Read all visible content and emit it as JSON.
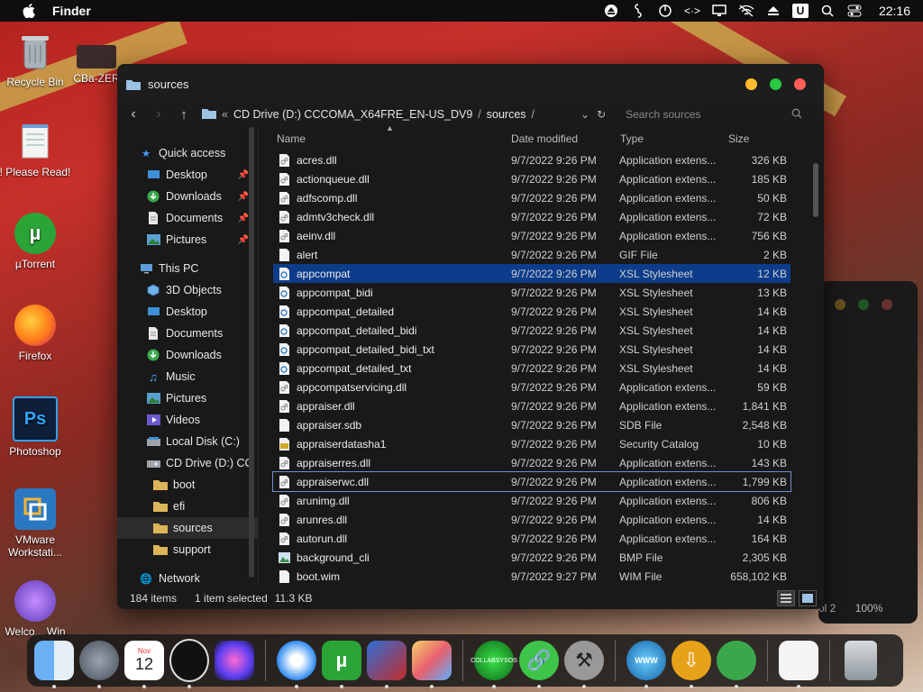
{
  "menubar": {
    "app_name": "Finder",
    "clock": "22:16"
  },
  "desktop": [
    {
      "label": "Recycle Bin",
      "icon": "recycle-bin-icon"
    },
    {
      "label": "CBa-ZER",
      "icon": "folder-photo-icon"
    },
    {
      "label": "! Please Read!",
      "icon": "notepad-icon"
    },
    {
      "label": "µTorrent",
      "icon": "utorrent-icon"
    },
    {
      "label": "Firefox",
      "icon": "firefox-icon"
    },
    {
      "label": "Photoshop",
      "icon": "photoshop-icon"
    },
    {
      "label": "VMware Workstati...",
      "icon": "vmware-icon"
    },
    {
      "label": "Welco... Win",
      "icon": "apple-icon"
    }
  ],
  "window": {
    "title": "sources",
    "breadcrumb": [
      "CD Drive (D:) CCCOMA_X64FRE_EN-US_DV9",
      "sources"
    ],
    "breadcrumb_prefix": "«",
    "search_placeholder": "Search sources"
  },
  "sidebar": {
    "quick_access": "Quick access",
    "quick_items": [
      {
        "label": "Desktop",
        "icon": "desktop-icon"
      },
      {
        "label": "Downloads",
        "icon": "download-icon"
      },
      {
        "label": "Documents",
        "icon": "documents-icon"
      },
      {
        "label": "Pictures",
        "icon": "pictures-icon"
      }
    ],
    "this_pc": "This PC",
    "pc_items": [
      {
        "label": "3D Objects",
        "icon": "cube-icon"
      },
      {
        "label": "Desktop",
        "icon": "desktop-icon"
      },
      {
        "label": "Documents",
        "icon": "documents-icon"
      },
      {
        "label": "Downloads",
        "icon": "download-icon"
      },
      {
        "label": "Music",
        "icon": "music-icon"
      },
      {
        "label": "Pictures",
        "icon": "pictures-icon"
      },
      {
        "label": "Videos",
        "icon": "videos-icon"
      },
      {
        "label": "Local Disk (C:)",
        "icon": "disk-icon"
      },
      {
        "label": "CD Drive (D:) CC",
        "icon": "cd-icon"
      }
    ],
    "cd_items": [
      {
        "label": "boot"
      },
      {
        "label": "efi"
      },
      {
        "label": "sources"
      },
      {
        "label": "support"
      }
    ],
    "network": "Network"
  },
  "columns": {
    "name": "Name",
    "date": "Date modified",
    "type": "Type",
    "size": "Size"
  },
  "files": [
    {
      "name": "acres.dll",
      "date": "9/7/2022 9:26 PM",
      "type": "Application extens...",
      "size": "326 KB",
      "icon": "dll-icon"
    },
    {
      "name": "actionqueue.dll",
      "date": "9/7/2022 9:26 PM",
      "type": "Application extens...",
      "size": "185 KB",
      "icon": "dll-icon"
    },
    {
      "name": "adfscomp.dll",
      "date": "9/7/2022 9:26 PM",
      "type": "Application extens...",
      "size": "50 KB",
      "icon": "dll-icon"
    },
    {
      "name": "admtv3check.dll",
      "date": "9/7/2022 9:26 PM",
      "type": "Application extens...",
      "size": "72 KB",
      "icon": "dll-icon"
    },
    {
      "name": "aeinv.dll",
      "date": "9/7/2022 9:26 PM",
      "type": "Application extens...",
      "size": "756 KB",
      "icon": "dll-icon"
    },
    {
      "name": "alert",
      "date": "9/7/2022 9:26 PM",
      "type": "GIF File",
      "size": "2 KB",
      "icon": "file-icon"
    },
    {
      "name": "appcompat",
      "date": "9/7/2022 9:26 PM",
      "type": "XSL Stylesheet",
      "size": "12 KB",
      "icon": "xsl-icon"
    },
    {
      "name": "appcompat_bidi",
      "date": "9/7/2022 9:26 PM",
      "type": "XSL Stylesheet",
      "size": "13 KB",
      "icon": "xsl-icon"
    },
    {
      "name": "appcompat_detailed",
      "date": "9/7/2022 9:26 PM",
      "type": "XSL Stylesheet",
      "size": "14 KB",
      "icon": "xsl-icon"
    },
    {
      "name": "appcompat_detailed_bidi",
      "date": "9/7/2022 9:26 PM",
      "type": "XSL Stylesheet",
      "size": "14 KB",
      "icon": "xsl-icon"
    },
    {
      "name": "appcompat_detailed_bidi_txt",
      "date": "9/7/2022 9:26 PM",
      "type": "XSL Stylesheet",
      "size": "14 KB",
      "icon": "xsl-icon"
    },
    {
      "name": "appcompat_detailed_txt",
      "date": "9/7/2022 9:26 PM",
      "type": "XSL Stylesheet",
      "size": "14 KB",
      "icon": "xsl-icon"
    },
    {
      "name": "appcompatservicing.dll",
      "date": "9/7/2022 9:26 PM",
      "type": "Application extens...",
      "size": "59 KB",
      "icon": "dll-icon"
    },
    {
      "name": "appraiser.dll",
      "date": "9/7/2022 9:26 PM",
      "type": "Application extens...",
      "size": "1,841 KB",
      "icon": "dll-icon"
    },
    {
      "name": "appraiser.sdb",
      "date": "9/7/2022 9:26 PM",
      "type": "SDB File",
      "size": "2,548 KB",
      "icon": "file-icon"
    },
    {
      "name": "appraiserdatasha1",
      "date": "9/7/2022 9:26 PM",
      "type": "Security Catalog",
      "size": "10 KB",
      "icon": "catalog-icon"
    },
    {
      "name": "appraiserres.dll",
      "date": "9/7/2022 9:26 PM",
      "type": "Application extens...",
      "size": "143 KB",
      "icon": "dll-icon"
    },
    {
      "name": "appraiserwc.dll",
      "date": "9/7/2022 9:26 PM",
      "type": "Application extens...",
      "size": "1,799 KB",
      "icon": "dll-icon"
    },
    {
      "name": "arunimg.dll",
      "date": "9/7/2022 9:26 PM",
      "type": "Application extens...",
      "size": "806 KB",
      "icon": "dll-icon"
    },
    {
      "name": "arunres.dll",
      "date": "9/7/2022 9:26 PM",
      "type": "Application extens...",
      "size": "14 KB",
      "icon": "dll-icon"
    },
    {
      "name": "autorun.dll",
      "date": "9/7/2022 9:26 PM",
      "type": "Application extens...",
      "size": "164 KB",
      "icon": "dll-icon"
    },
    {
      "name": "background_cli",
      "date": "9/7/2022 9:26 PM",
      "type": "BMP File",
      "size": "2,305 KB",
      "icon": "bmp-icon"
    },
    {
      "name": "boot.wim",
      "date": "9/7/2022 9:27 PM",
      "type": "WIM File",
      "size": "658,102 KB",
      "icon": "file-icon"
    }
  ],
  "selected_index": 6,
  "focused_index": 17,
  "status": {
    "count": "184 items",
    "selected": "1 item selected",
    "size": "11.3 KB"
  },
  "bg_window_status": {
    "page": "ol 2",
    "zoom": "100%"
  },
  "dock": [
    {
      "icon": "finder-icon"
    },
    {
      "icon": "launchpad-icon"
    },
    {
      "icon": "calendar-icon",
      "month": "Nov",
      "day": "12"
    },
    {
      "icon": "clock-icon"
    },
    {
      "icon": "siri-icon"
    },
    {
      "icon": "safari-icon"
    },
    {
      "icon": "utorrent-icon"
    },
    {
      "icon": "windows-icon"
    },
    {
      "icon": "preview-icon"
    },
    {
      "icon": "collabsysos-icon",
      "label": "COLLABSYSOS"
    },
    {
      "icon": "link-icon"
    },
    {
      "icon": "tools-icon"
    },
    {
      "icon": "www-icon"
    },
    {
      "icon": "download-arrow-icon"
    },
    {
      "icon": "network-dots-icon"
    },
    {
      "icon": "textedit-icon"
    },
    {
      "icon": "trash-icon"
    }
  ],
  "colors": {
    "selection": "#0c3c8a",
    "close": "#ff5f57",
    "minimize": "#febc2e",
    "zoom": "#28c840"
  }
}
